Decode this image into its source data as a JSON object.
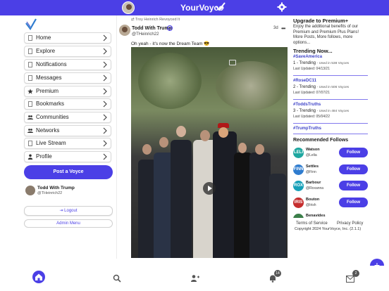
{
  "header": {
    "brand": "YourVoyce",
    "icons": [
      "user-avatar",
      "brand-check-icon",
      "gear-icon"
    ]
  },
  "sidebar": {
    "items": [
      {
        "label": "Home",
        "icon": "page-icon"
      },
      {
        "label": "Explore",
        "icon": "page-icon"
      },
      {
        "label": "Notifications",
        "icon": "page-icon"
      },
      {
        "label": "Messages",
        "icon": "page-icon"
      },
      {
        "label": "Premium",
        "icon": "star-icon"
      },
      {
        "label": "Bookmarks",
        "icon": "page-icon"
      },
      {
        "label": "Communities",
        "icon": "group-icon"
      },
      {
        "label": "Networks",
        "icon": "group-icon"
      },
      {
        "label": "Live Stream",
        "icon": "page-icon"
      },
      {
        "label": "Profile",
        "icon": "person-icon"
      }
    ],
    "post_button": "Post a Voyce",
    "user": {
      "name": "Todd With Trump",
      "handle": "@THeinrich22"
    },
    "logout": "Logout",
    "admin": "Admin Menu"
  },
  "post": {
    "repost_note": "Troy Heinrich Revoyced It",
    "author": "Todd With Trump",
    "handle": "@THeinrich22",
    "time": "3d",
    "more": "•••",
    "text": "Oh yeah - it's now the Dream Team 😎"
  },
  "right": {
    "upgrade_title": "Upgrade to Premium+",
    "upgrade_text": "Enjoy the additional benefits of our Premium and Premium Plus Plans! More Posts, More follows, more options...",
    "trending_title": "Trending Now...",
    "trends": [
      {
        "tag": "#SaveAmerica",
        "rank": "1 - Trending",
        "used": "- Used in 538 Voyces",
        "updated": "Last Updated: 04/13/21"
      },
      {
        "tag": "#RoseDC11",
        "rank": "2 - Trending",
        "used": "- Used in 506 Voyces",
        "updated": "Last Updated: 07/07/21"
      },
      {
        "tag": "#ToddsTruths",
        "rank": "3 - Trending",
        "used": "- Used in 484 Voyces",
        "updated": "Last Updated: 05/04/22"
      },
      {
        "tag": "#TrumpTruths",
        "rank": "",
        "used": "",
        "updated": ""
      }
    ],
    "recommended_title": "Recommended Follows",
    "recommended": [
      {
        "initials": "LELI",
        "name": "Watson",
        "handle": "@Lelia",
        "follow": "Follow",
        "color": "#1fa7a0"
      },
      {
        "initials": "FINN",
        "name": "Settles",
        "handle": "@Finn",
        "follow": "Follow",
        "color": "#2f7ccf"
      },
      {
        "initials": "ROX",
        "name": "Barbour",
        "handle": "@Roxanna",
        "follow": "Follow",
        "color": "#16a0b8"
      },
      {
        "initials": "IRIS",
        "name": "Bouton",
        "handle": "@Irish",
        "follow": "Follow",
        "color": "#c52d2d"
      },
      {
        "initials": "",
        "name": "Benavides",
        "handle": "",
        "follow": "",
        "color": "#3b7f4a"
      }
    ],
    "footer_terms": "Terms of Service",
    "footer_privacy": "Privacy Policy",
    "footer_copy": "Copyright 2024 YourVoyce, Inc. (2.1.1)"
  },
  "bottom_nav": {
    "notifications_badge": "14",
    "messages_badge": "2"
  },
  "fab_label": "+",
  "colors": {
    "accent": "#4b3fe6",
    "link": "#3f44c8"
  }
}
